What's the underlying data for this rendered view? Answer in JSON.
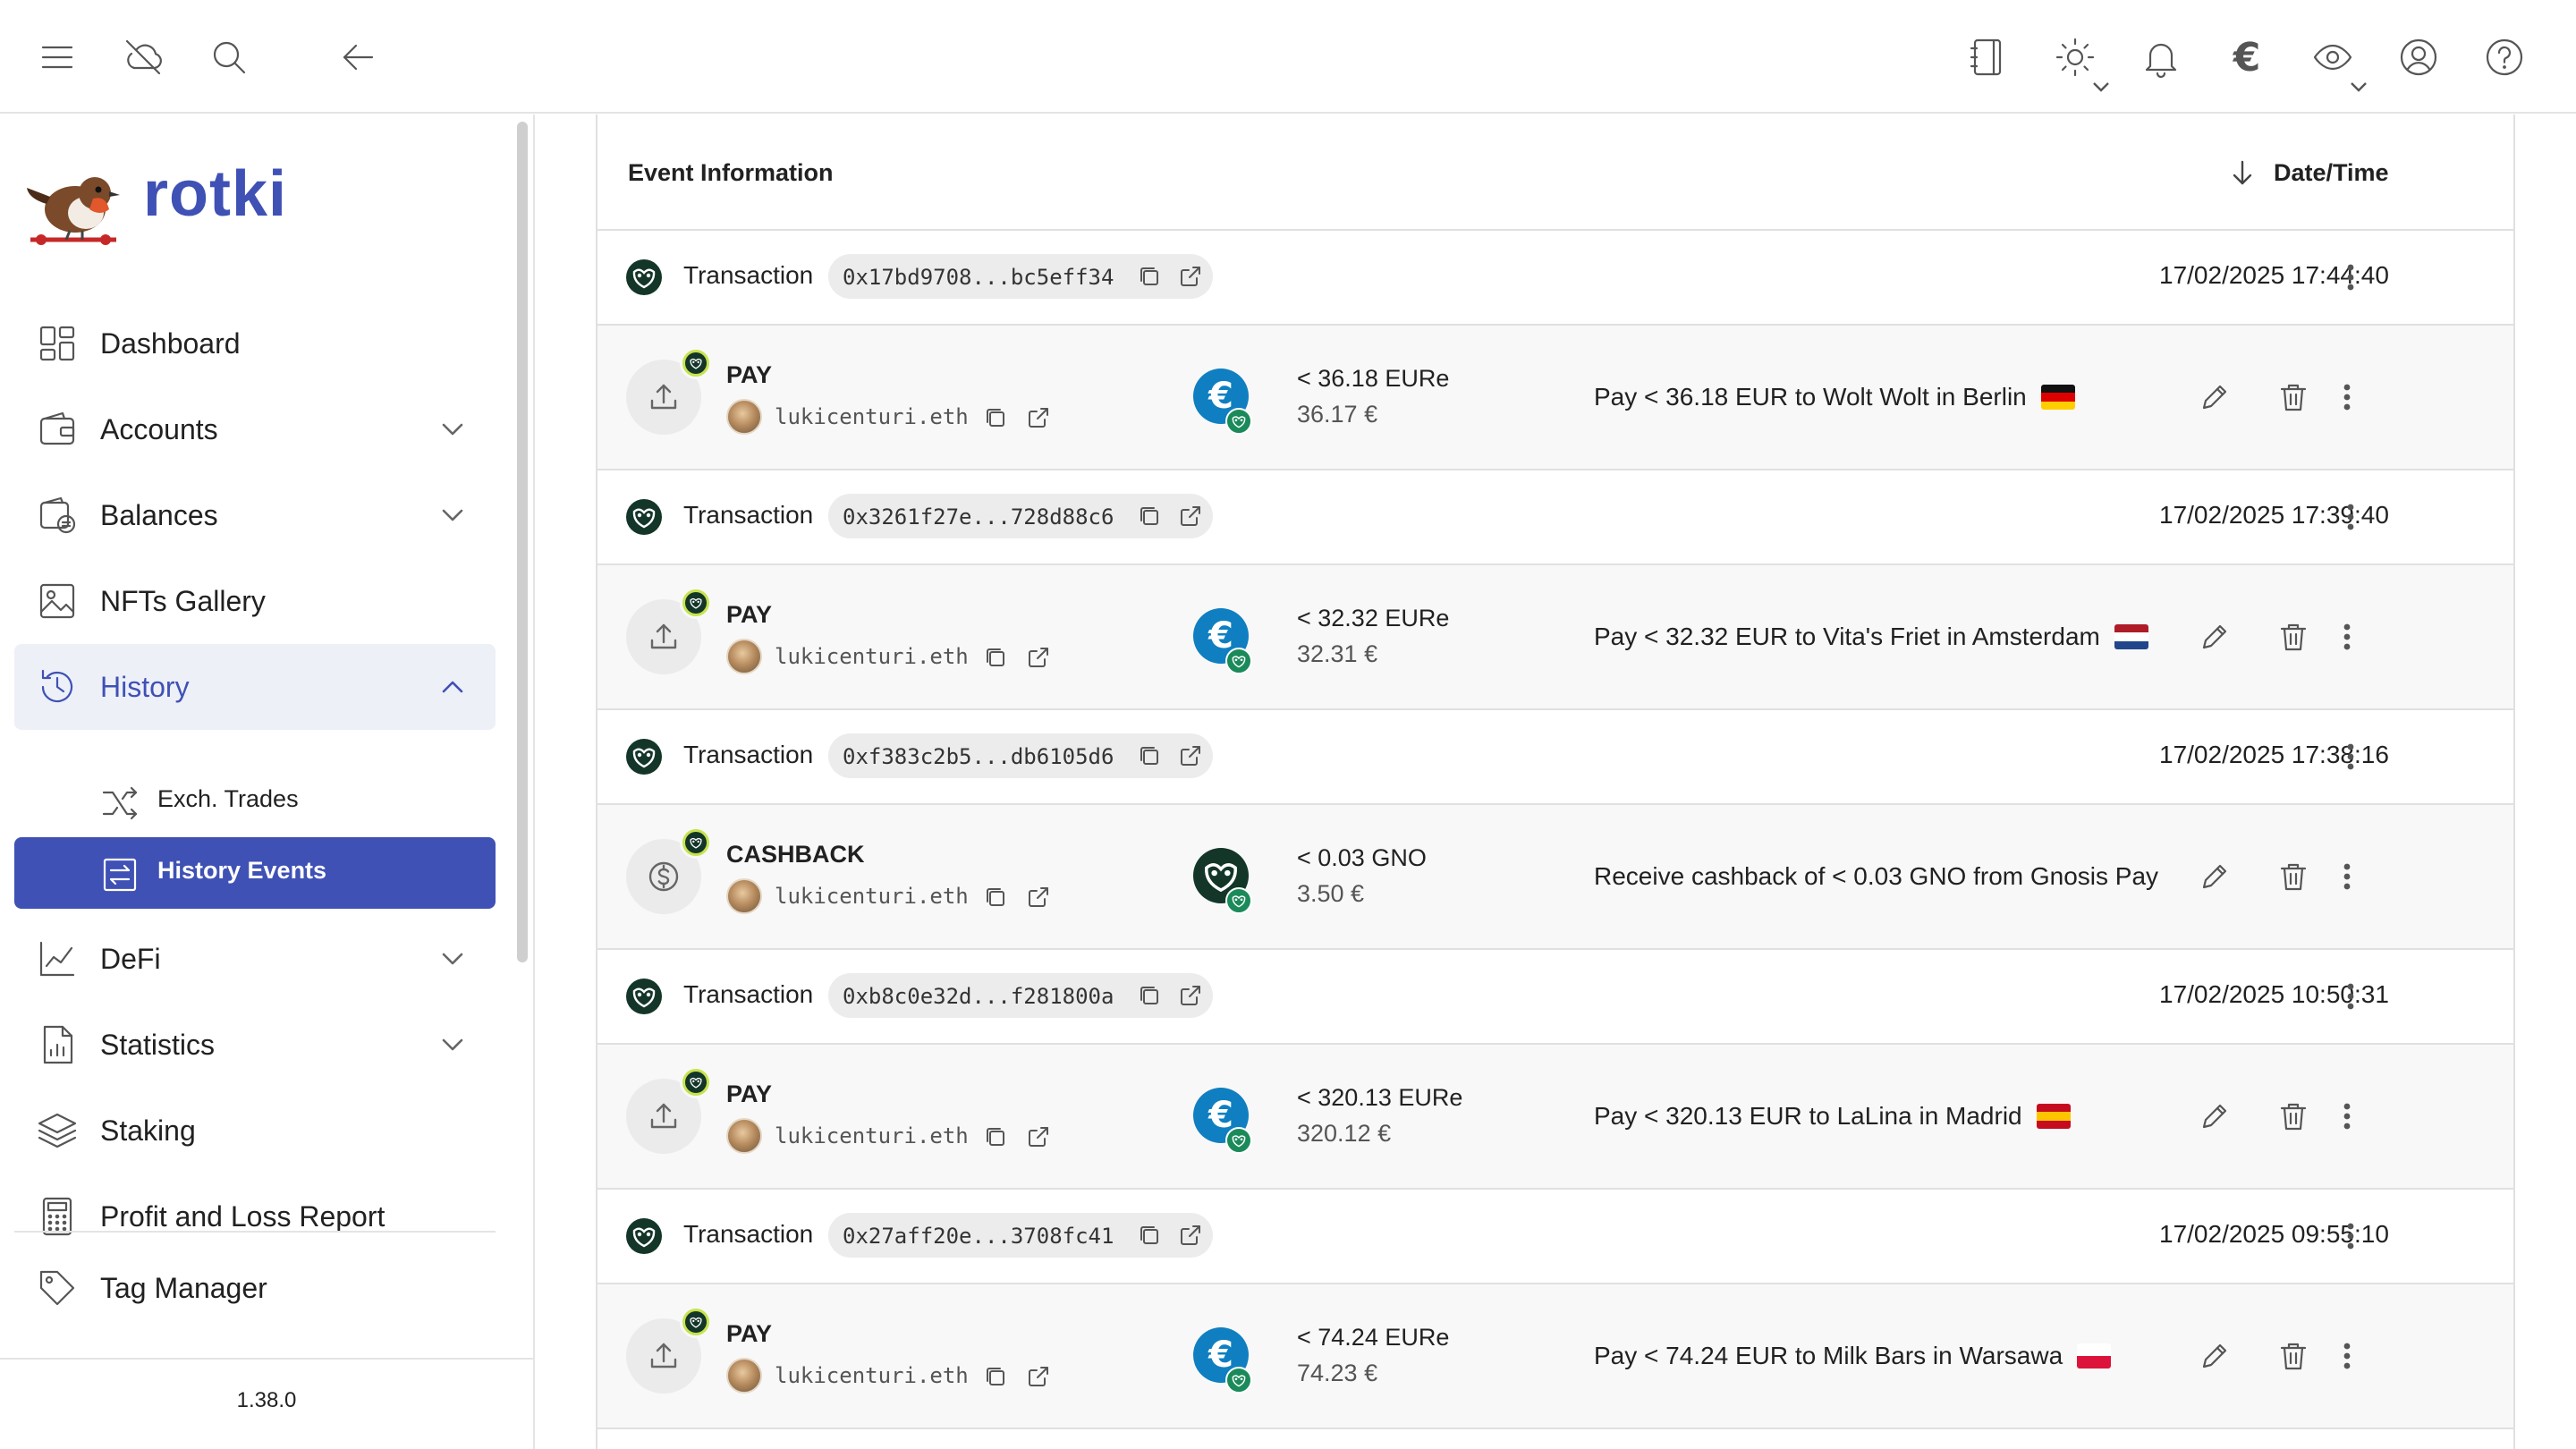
{
  "app": {
    "name": "rotki",
    "version": "1.38.0"
  },
  "topbar": {
    "left_icons": [
      "menu-icon",
      "cloud-off-icon",
      "search-icon",
      "arrow-left-icon"
    ],
    "right_icons": [
      "notes-icon",
      "theme-sun-icon",
      "bell-icon",
      "euro-currency-icon",
      "privacy-eye-icon",
      "account-icon",
      "help-icon"
    ],
    "currency_symbol": "€"
  },
  "sidebar": {
    "items": [
      {
        "label": "Dashboard",
        "icon": "dashboard-icon"
      },
      {
        "label": "Accounts",
        "icon": "wallet-icon"
      },
      {
        "label": "Balances",
        "icon": "balances-icon"
      },
      {
        "label": "NFTs Gallery",
        "icon": "image-icon"
      },
      {
        "label": "History",
        "icon": "history-icon"
      },
      {
        "label": "DeFi",
        "icon": "chart-line-icon"
      },
      {
        "label": "Statistics",
        "icon": "statistics-icon"
      },
      {
        "label": "Staking",
        "icon": "stack-icon"
      },
      {
        "label": "Profit and Loss Report",
        "icon": "calculator-icon"
      },
      {
        "label": "Tag Manager",
        "icon": "tag-icon"
      }
    ],
    "history_sub": [
      {
        "label": "Exch. Trades",
        "icon": "shuffle-icon"
      },
      {
        "label": "History Events",
        "icon": "exchange-box-icon"
      }
    ]
  },
  "table": {
    "col_event": "Event Information",
    "col_date": "Date/Time",
    "groups": [
      {
        "tx_label": "Transaction",
        "hash": "0x17bd9708...bc5eff34",
        "date": "17/02/2025 17:44:40",
        "event": {
          "type": "PAY",
          "ens": "lukicenturi.eth",
          "asset_symbol": "€",
          "asset_kind": "eure",
          "amount": "< 36.18 EURe",
          "fiat": "36.17 €",
          "description": "Pay < 36.18 EUR to Wolt Wolt in Berlin",
          "flag": "de"
        }
      },
      {
        "tx_label": "Transaction",
        "hash": "0x3261f27e...728d88c6",
        "date": "17/02/2025 17:39:40",
        "event": {
          "type": "PAY",
          "ens": "lukicenturi.eth",
          "asset_symbol": "€",
          "asset_kind": "eure",
          "amount": "< 32.32 EURe",
          "fiat": "32.31 €",
          "description": "Pay < 32.32 EUR to Vita's Friet in Amsterdam",
          "flag": "nl"
        }
      },
      {
        "tx_label": "Transaction",
        "hash": "0xf383c2b5...db6105d6",
        "date": "17/02/2025 17:38:16",
        "event": {
          "type": "CASHBACK",
          "ens": "lukicenturi.eth",
          "asset_symbol": "",
          "asset_kind": "gno",
          "amount": "< 0.03 GNO",
          "fiat": "3.50 €",
          "description": "Receive cashback of < 0.03 GNO from Gnosis Pay",
          "flag": ""
        }
      },
      {
        "tx_label": "Transaction",
        "hash": "0xb8c0e32d...f281800a",
        "date": "17/02/2025 10:50:31",
        "event": {
          "type": "PAY",
          "ens": "lukicenturi.eth",
          "asset_symbol": "€",
          "asset_kind": "eure",
          "amount": "< 320.13 EURe",
          "fiat": "320.12 €",
          "description": "Pay < 320.13 EUR to LaLina in Madrid",
          "flag": "es"
        }
      },
      {
        "tx_label": "Transaction",
        "hash": "0x27aff20e...3708fc41",
        "date": "17/02/2025 09:55:10",
        "event": {
          "type": "PAY",
          "ens": "lukicenturi.eth",
          "asset_symbol": "€",
          "asset_kind": "eure",
          "amount": "< 74.24 EURe",
          "fiat": "74.23 €",
          "description": "Pay < 74.24 EUR to Milk Bars in Warsawa",
          "flag": "pl"
        }
      }
    ]
  },
  "colors": {
    "accent": "#3f51b5",
    "gnosis_green": "#133629",
    "eure_blue": "#0f7fc1",
    "badge_lime": "#c7e34d"
  }
}
